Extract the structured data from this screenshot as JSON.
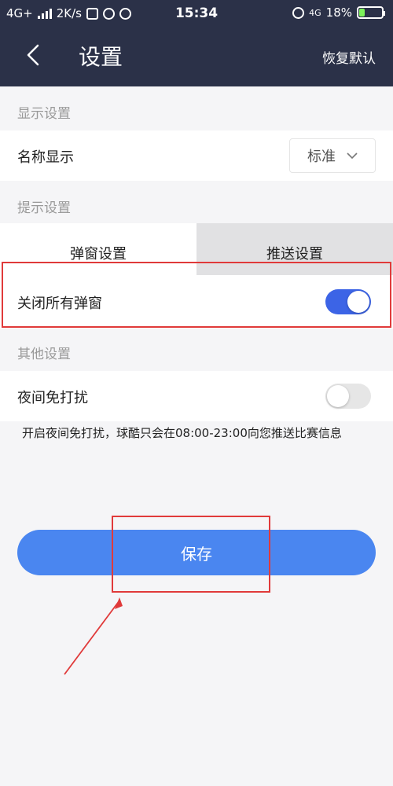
{
  "status_bar": {
    "network": "4G+",
    "speed": "2K/s",
    "time": "15:34",
    "network_right": "4G",
    "battery": "18%"
  },
  "nav": {
    "title": "设置",
    "right_action": "恢复默认"
  },
  "display_settings": {
    "header": "显示设置",
    "name_display_label": "名称显示",
    "name_display_value": "标准"
  },
  "prompt_settings": {
    "header": "提示设置",
    "tabs": [
      {
        "label": "弹窗设置",
        "active": true
      },
      {
        "label": "推送设置",
        "active": false
      }
    ],
    "close_all_popups_label": "关闭所有弹窗",
    "close_all_popups_on": true
  },
  "other_settings": {
    "header": "其他设置",
    "do_not_disturb_label": "夜间免打扰",
    "do_not_disturb_on": false,
    "hint": "开启夜间免打扰，球酷只会在08:00-23:00向您推送比赛信息"
  },
  "save_button": {
    "label": "保存"
  },
  "colors": {
    "header_bg": "#2b3148",
    "accent": "#3c64e6",
    "save_bg": "#4a86f0",
    "annotation": "#e03a3a"
  }
}
